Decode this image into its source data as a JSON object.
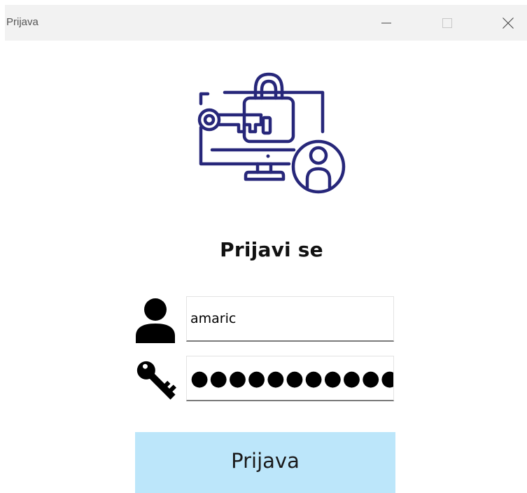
{
  "window": {
    "title": "Prijava"
  },
  "hero": {
    "icon": "computer-lock-key-user-icon",
    "color": "#27277a"
  },
  "form": {
    "heading": "Prijavi se",
    "username": {
      "icon": "user-icon",
      "value": "amaric"
    },
    "password": {
      "icon": "key-icon",
      "value": "●●●●●●●●●●●"
    },
    "submit_label": "Prijava",
    "submit_color": "#bce6fa"
  }
}
